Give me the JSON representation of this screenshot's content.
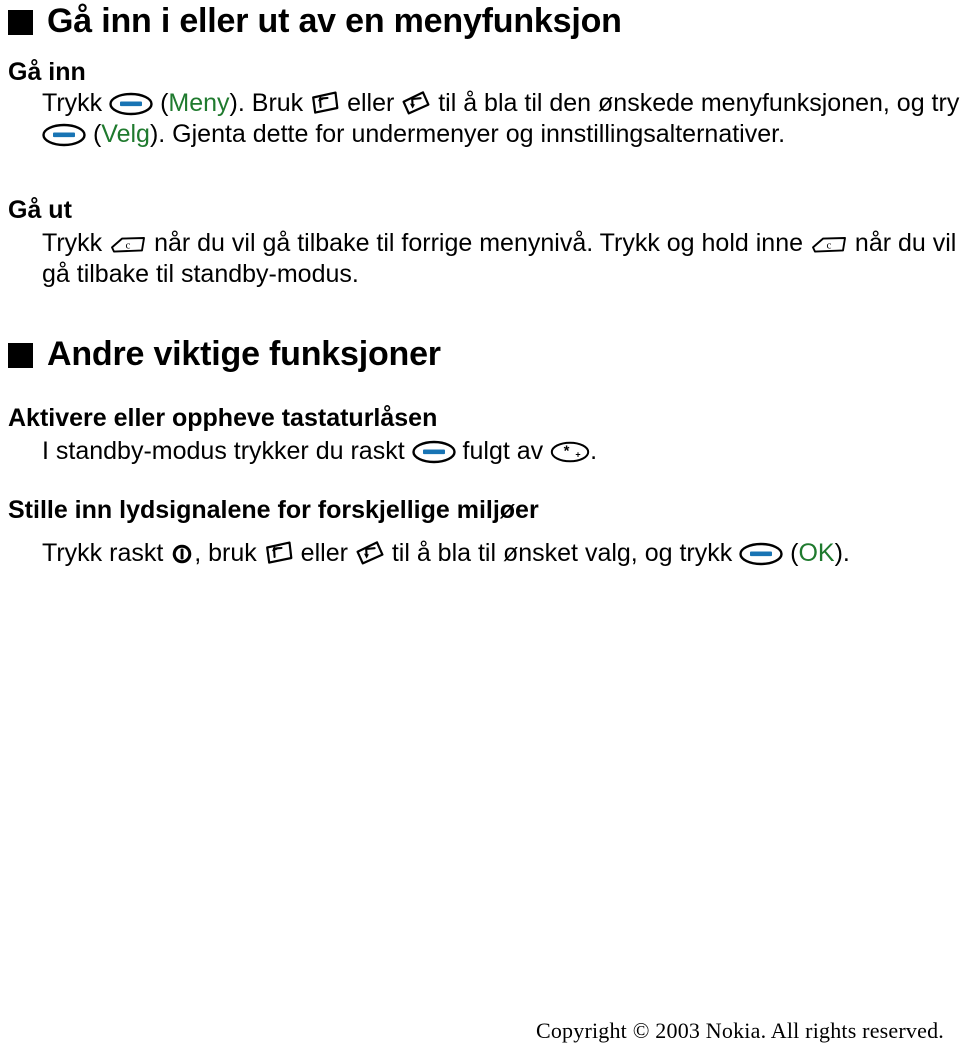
{
  "document": {
    "language": "nb-NO",
    "product": "Nokia"
  },
  "sections": [
    {
      "id": "enter-exit-menu",
      "heading": "Gå inn i eller ut av en menyfunksjon",
      "bullet_icon": "filled-square-bullet",
      "blocks": [
        {
          "id": "go-in",
          "subheading": "Gå inn",
          "parts": [
            {
              "type": "text",
              "value": "Trykk "
            },
            {
              "type": "icon",
              "icon": "select-key-icon",
              "label": "Velg-tast"
            },
            {
              "type": "text",
              "value": " ("
            },
            {
              "type": "green",
              "value": "Meny"
            },
            {
              "type": "text",
              "value": "). Bruk "
            },
            {
              "type": "icon",
              "icon": "scroll-up-key-icon",
              "label": "Bla opp"
            },
            {
              "type": "text",
              "value": " eller "
            },
            {
              "type": "icon",
              "icon": "scroll-down-key-icon",
              "label": "Bla ned"
            },
            {
              "type": "text",
              "value": " til å bla til den ønskede menyfunksjonen, og trykk "
            },
            {
              "type": "icon",
              "icon": "select-key-icon",
              "label": "Velg-tast"
            },
            {
              "type": "text",
              "value": " ("
            },
            {
              "type": "green",
              "value": "Velg"
            },
            {
              "type": "text",
              "value": "). Gjenta dette for undermenyer og innstillingsalternativer."
            }
          ]
        },
        {
          "id": "go-out",
          "subheading": "Gå ut",
          "parts": [
            {
              "type": "text",
              "value": "Trykk "
            },
            {
              "type": "icon",
              "icon": "clear-key-icon",
              "label": "Slett-tast (C)"
            },
            {
              "type": "text",
              "value": " når du vil gå tilbake til forrige menynivå. Trykk og hold inne "
            },
            {
              "type": "icon",
              "icon": "clear-key-icon",
              "label": "Slett-tast (C)"
            },
            {
              "type": "text",
              "value": " når du vil gå tilbake til standby-modus."
            }
          ]
        }
      ]
    },
    {
      "id": "other-important-functions",
      "heading": "Andre viktige funksjoner",
      "bullet_icon": "filled-square-bullet",
      "blocks": [
        {
          "id": "keyguard",
          "subheading": "Aktivere eller oppheve tastaturlåsen",
          "parts": [
            {
              "type": "text",
              "value": "I standby-modus trykker du raskt "
            },
            {
              "type": "icon",
              "icon": "select-key-icon",
              "label": "Velg-tast"
            },
            {
              "type": "text",
              "value": " fulgt av "
            },
            {
              "type": "icon",
              "icon": "star-key-icon",
              "label": "Stjernetast"
            },
            {
              "type": "text",
              "value": "."
            }
          ]
        },
        {
          "id": "profiles",
          "subheading": "Stille inn lydsignalene for forskjellige miljøer",
          "parts": [
            {
              "type": "text",
              "value": "Trykk raskt "
            },
            {
              "type": "icon",
              "icon": "power-key-icon",
              "label": "Av/på-tast"
            },
            {
              "type": "text",
              "value": ", bruk "
            },
            {
              "type": "icon",
              "icon": "scroll-up-key-icon",
              "label": "Bla opp"
            },
            {
              "type": "text",
              "value": " eller "
            },
            {
              "type": "icon",
              "icon": "scroll-down-key-icon",
              "label": "Bla ned"
            },
            {
              "type": "text",
              "value": " til å bla til ønsket valg, og trykk "
            },
            {
              "type": "icon",
              "icon": "select-key-icon",
              "label": "Velg-tast"
            },
            {
              "type": "text",
              "value": " ("
            },
            {
              "type": "green",
              "value": "OK"
            },
            {
              "type": "text",
              "value": ")."
            }
          ]
        }
      ]
    }
  ],
  "footer": {
    "copyright": "Copyright © 2003 Nokia. All rights reserved."
  },
  "colors": {
    "accent_green": "#1f7a2e",
    "key_blue": "#1874b4",
    "text": "#000000",
    "background": "#ffffff"
  }
}
